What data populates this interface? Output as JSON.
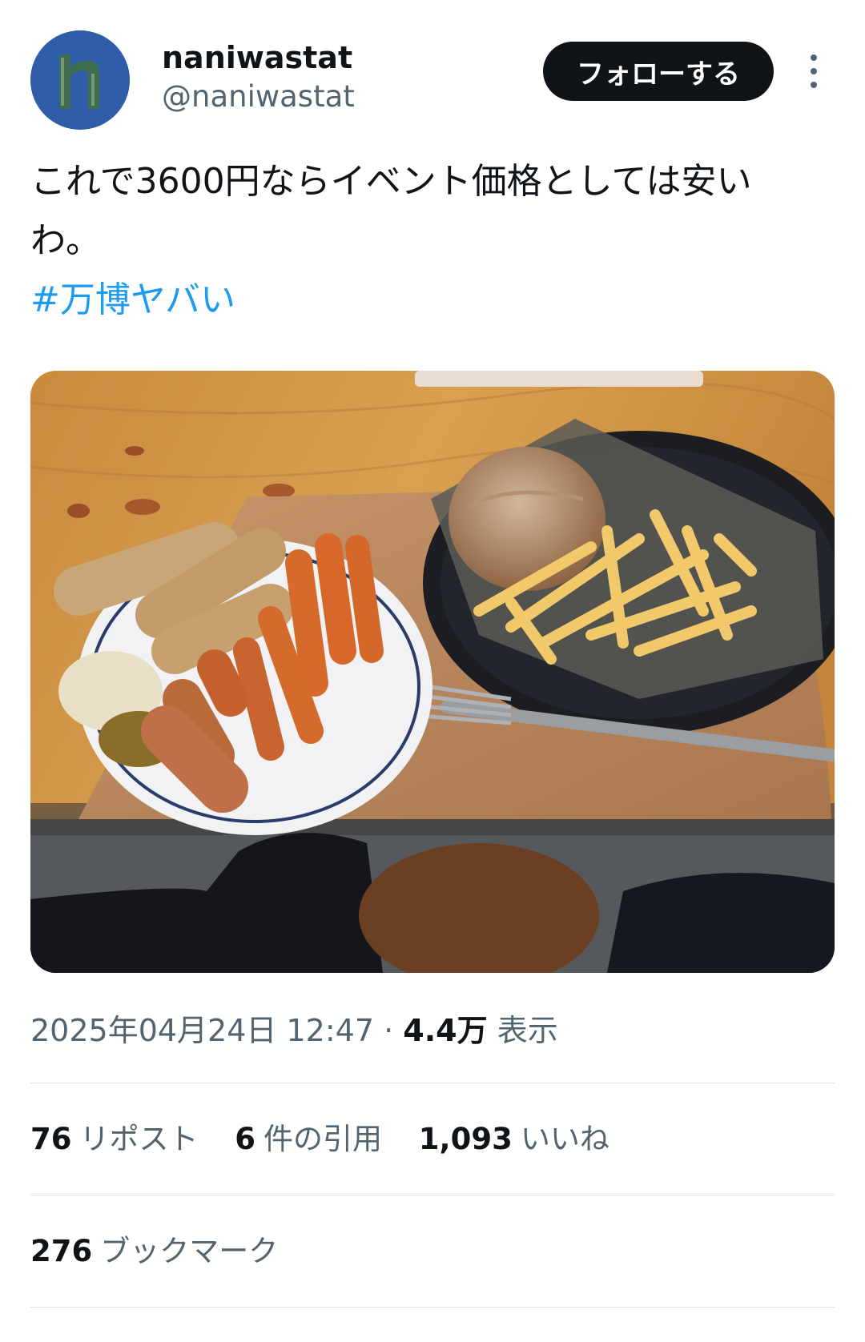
{
  "user": {
    "display_name": "naniwastat",
    "handle": "@naniwastat",
    "avatar_letter": "n"
  },
  "follow_label": "フォローする",
  "tweet": {
    "line1": "これで3600円ならイベント価格としては安い",
    "line2": "わ。",
    "hashtag": "#万博ヤバい"
  },
  "meta": {
    "timestamp": "2025年04月24日 12:47",
    "separator": "·",
    "views_count": "4.4万",
    "views_label": "表示"
  },
  "stats": {
    "reposts_count": "76",
    "reposts_label": "リポスト",
    "quotes_count": "6",
    "quotes_label": "件の引用",
    "likes_count": "1,093",
    "likes_label": "いいね",
    "bookmarks_count": "276",
    "bookmarks_label": "ブックマーク"
  },
  "colors": {
    "link": "#1d9bf0",
    "text": "#0f1419",
    "secondary": "#536471",
    "button_bg": "#0f1419"
  }
}
